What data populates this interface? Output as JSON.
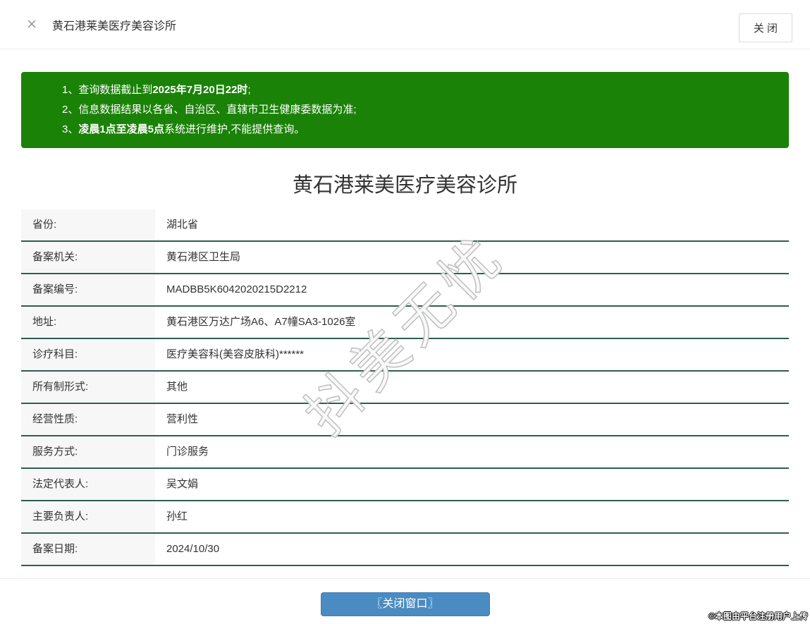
{
  "header": {
    "close_icon": "×",
    "title": "黄石港莱美医疗美容诊所",
    "close_button_label": "关 闭"
  },
  "notice": {
    "bg_color": "#1b8208",
    "lines": [
      {
        "prefix": "1、查询数据截止到",
        "bold": "2025年7月20日22时",
        "suffix": ";"
      },
      {
        "prefix": "2、信息数据结果以各省、自治区、直辖市卫生健康委数据为准;",
        "bold": "",
        "suffix": ""
      },
      {
        "prefix": "3、",
        "bold": "凌晨1点至凌晨5点",
        "suffix": "系统进行维护,不能提供查询。"
      }
    ]
  },
  "detail": {
    "title": "黄石港莱美医疗美容诊所",
    "divider_color": "#2e5d53",
    "rows": [
      {
        "label": "省份:",
        "value": "湖北省"
      },
      {
        "label": "备案机关:",
        "value": "黄石港区卫生局"
      },
      {
        "label": "备案编号:",
        "value": "MADBB5K6042020215D2212"
      },
      {
        "label": "地址:",
        "value": "黄石港区万达广场A6、A7幢SA3-1026室"
      },
      {
        "label": "诊疗科目:",
        "value": "医疗美容科(美容皮肤科)******"
      },
      {
        "label": "所有制形式:",
        "value": "其他"
      },
      {
        "label": "经营性质:",
        "value": "营利性"
      },
      {
        "label": "服务方式:",
        "value": "门诊服务"
      },
      {
        "label": "法定代表人:",
        "value": "吴文娟"
      },
      {
        "label": "主要负责人:",
        "value": "孙红"
      },
      {
        "label": "备案日期:",
        "value": "2024/10/30"
      }
    ]
  },
  "footer": {
    "close_window_button": "〖关闭窗口〗",
    "button_color": "#4a8bc2"
  },
  "watermark": {
    "text": "抖美无忧"
  },
  "copyright": "©本图由平台注册用户上传"
}
